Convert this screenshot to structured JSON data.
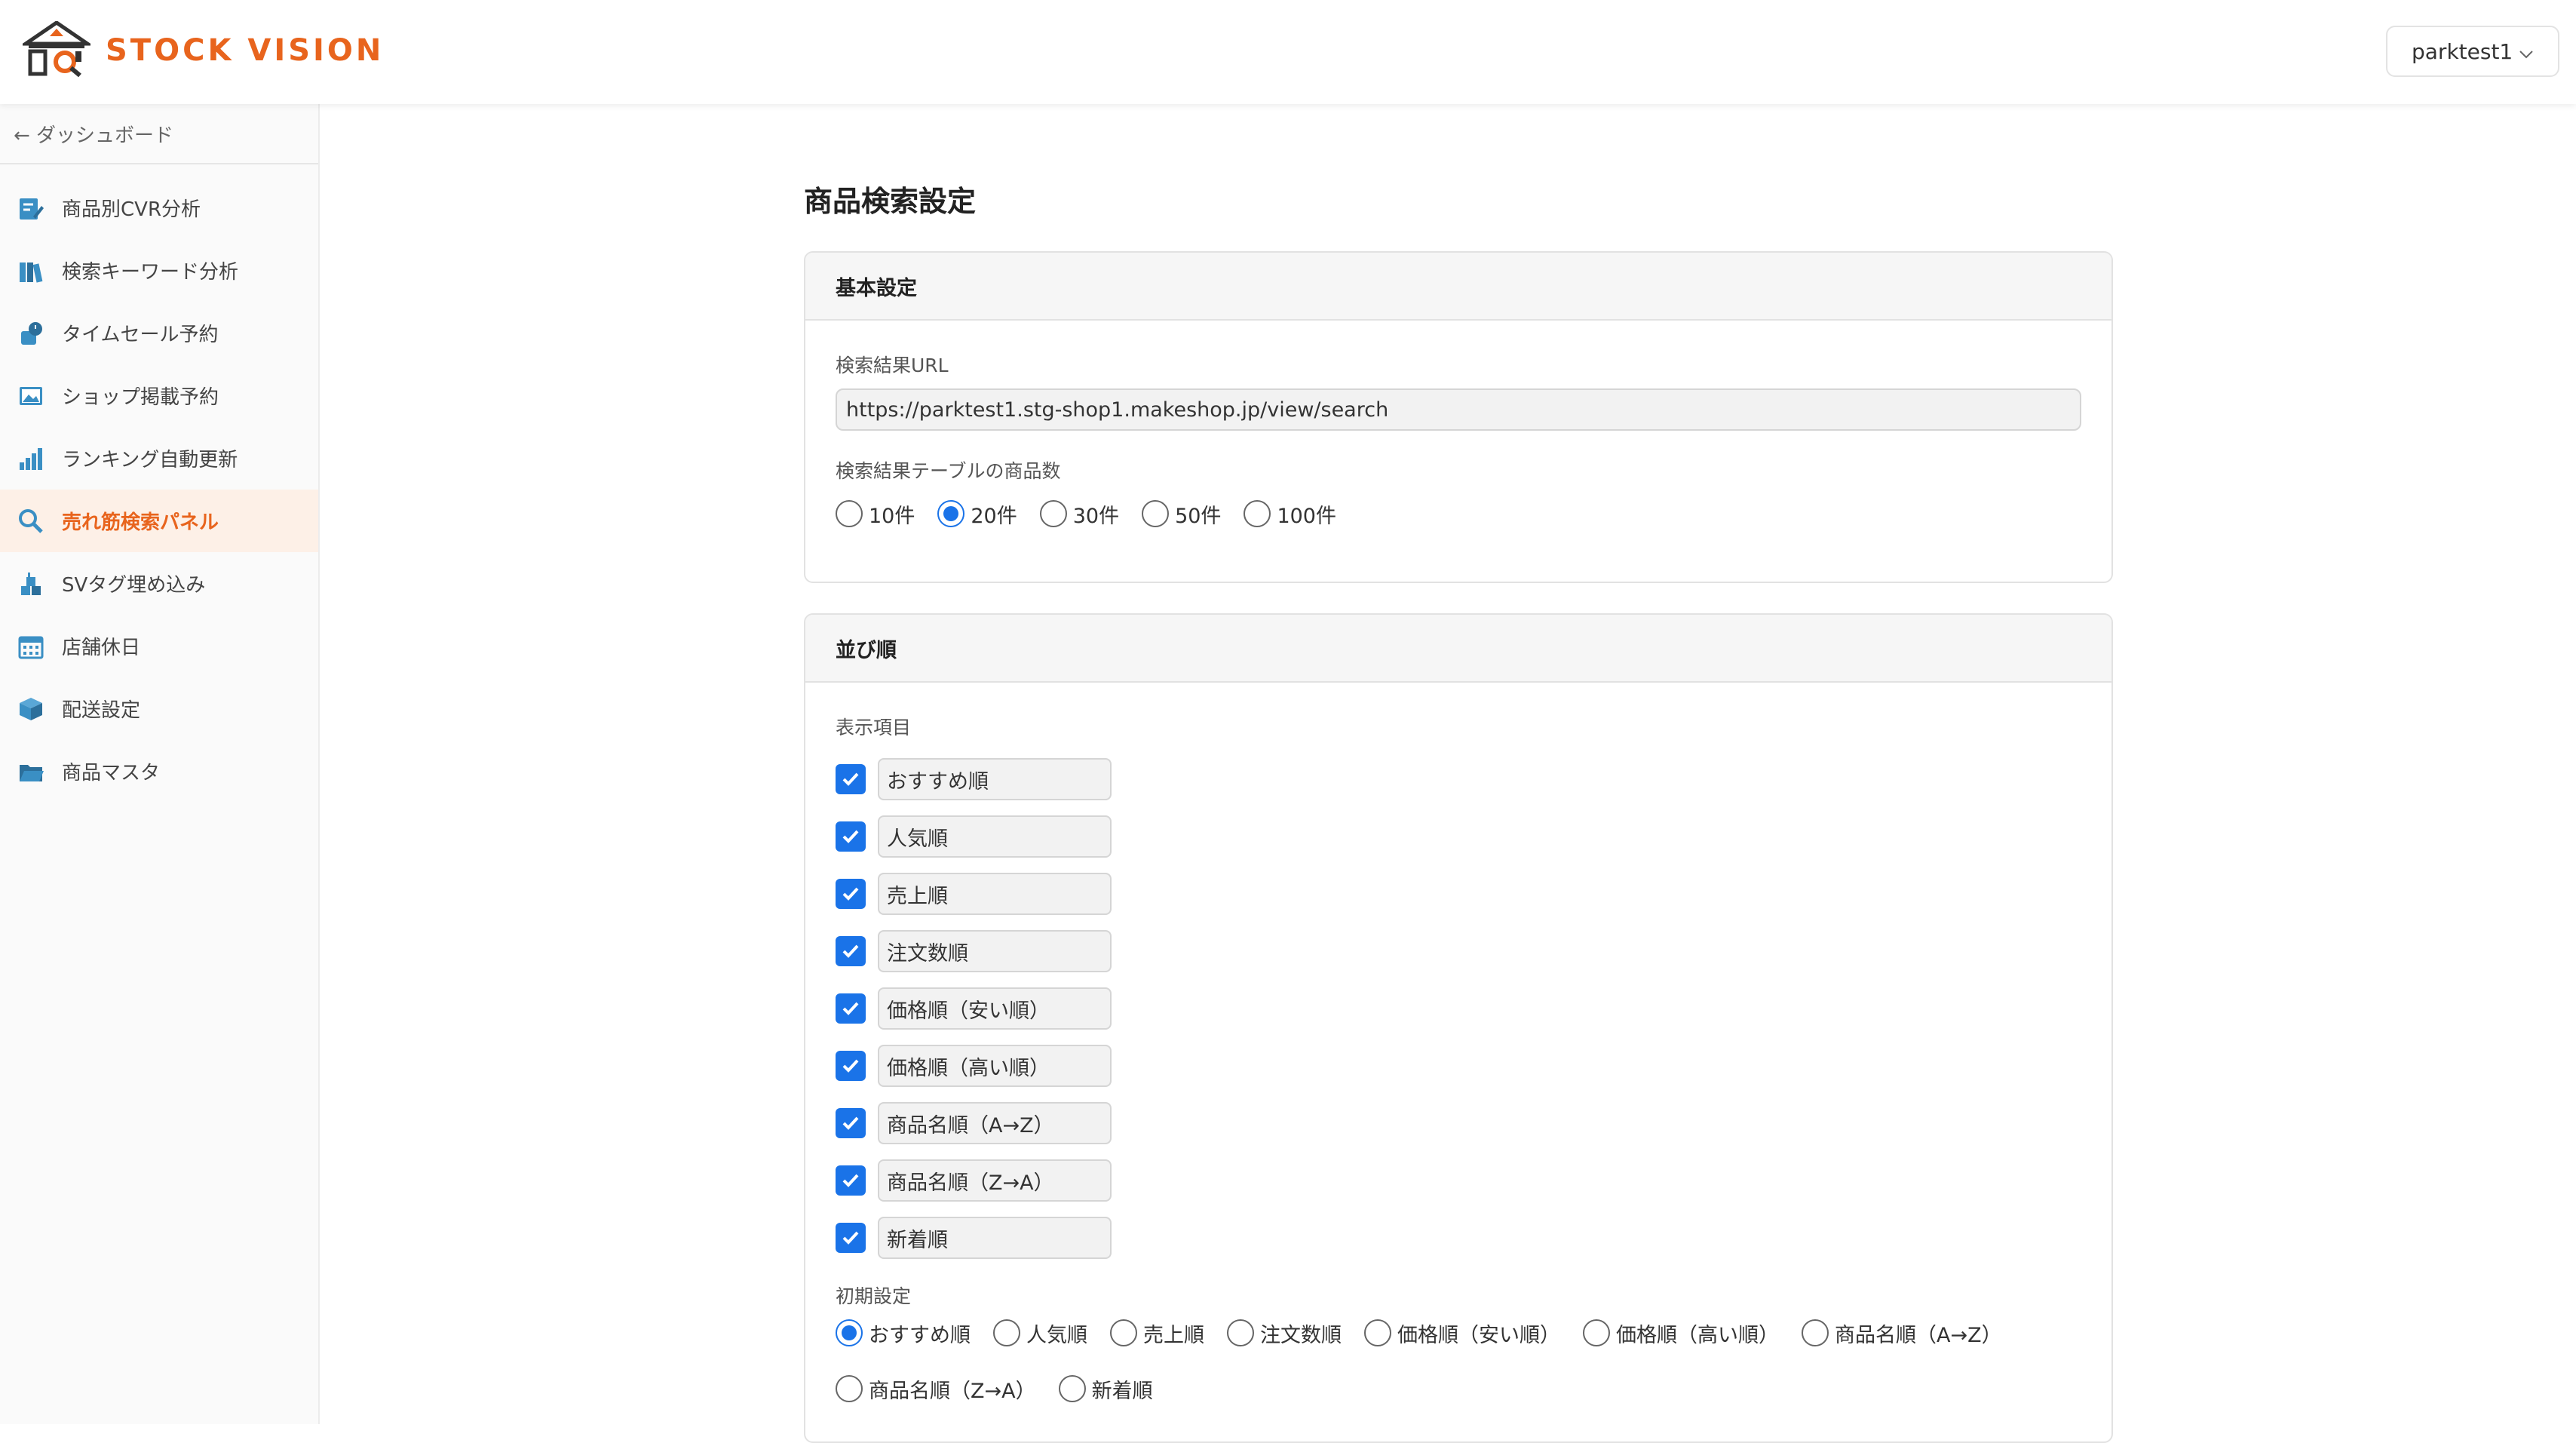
{
  "brand": {
    "name": "STOCK VISION"
  },
  "user": {
    "name": "parktest1"
  },
  "sidebar": {
    "back_label": "← ダッシュボード",
    "items": [
      {
        "label": "商品別CVR分析",
        "icon": "edit-chart-icon"
      },
      {
        "label": "検索キーワード分析",
        "icon": "books-icon"
      },
      {
        "label": "タイムセール予約",
        "icon": "timer-icon"
      },
      {
        "label": "ショップ掲載予約",
        "icon": "image-icon"
      },
      {
        "label": "ランキング自動更新",
        "icon": "bar-chart-icon"
      },
      {
        "label": "売れ筋検索パネル",
        "icon": "search-icon",
        "active": true
      },
      {
        "label": "SVタグ埋め込み",
        "icon": "blocks-icon"
      },
      {
        "label": "店舗休日",
        "icon": "calendar-icon"
      },
      {
        "label": "配送設定",
        "icon": "box-icon"
      },
      {
        "label": "商品マスタ",
        "icon": "folder-icon"
      }
    ]
  },
  "main": {
    "title": "商品検索設定",
    "basic": {
      "header": "基本設定",
      "url_label": "検索結果URL",
      "url_value": "https://parktest1.stg-shop1.makeshop.jp/view/search",
      "count_label": "検索結果テーブルの商品数",
      "count_options": [
        "10件",
        "20件",
        "30件",
        "50件",
        "100件"
      ],
      "count_selected": "20件"
    },
    "sort": {
      "header": "並び順",
      "display_label": "表示項目",
      "display_items": [
        "おすすめ順",
        "人気順",
        "売上順",
        "注文数順",
        "価格順（安い順）",
        "価格順（高い順）",
        "商品名順（A→Z）",
        "商品名順（Z→A）",
        "新着順"
      ],
      "default_label": "初期設定",
      "default_options": [
        "おすすめ順",
        "人気順",
        "売上順",
        "注文数順",
        "価格順（安い順）",
        "価格順（高い順）",
        "商品名順（A→Z）",
        "商品名順（Z→A）",
        "新着順"
      ],
      "default_selected": "おすすめ順"
    }
  },
  "colors": {
    "accent": "#e8641d",
    "primary": "#1a73e8",
    "icon": "#3a8fc4"
  }
}
